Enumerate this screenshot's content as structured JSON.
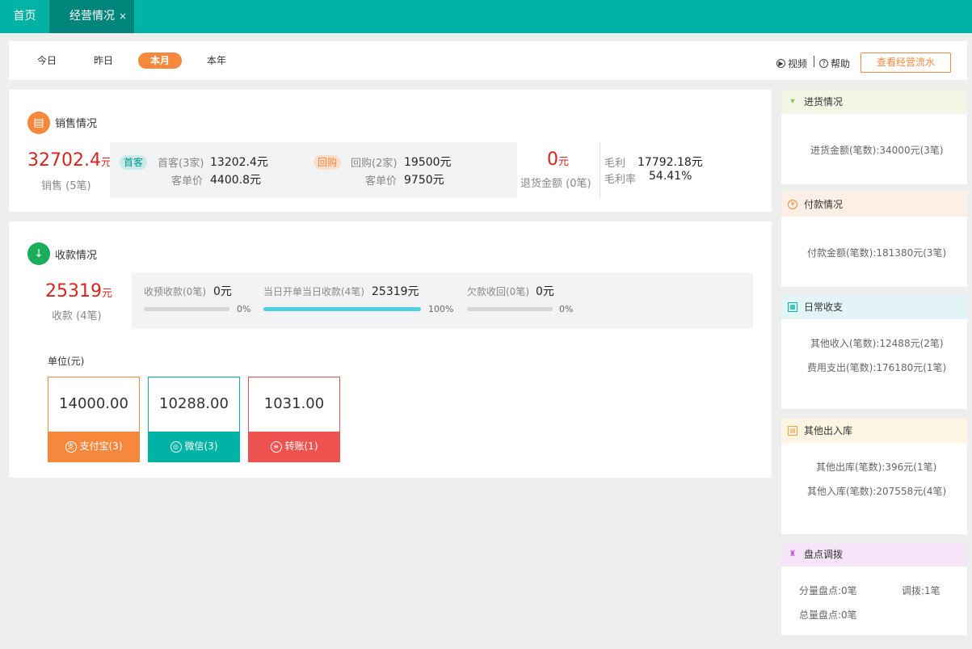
{
  "tabs": {
    "home": "首页",
    "active": "经营情况",
    "close": "×"
  },
  "filters": [
    "今日",
    "昨日",
    "本月",
    "本年"
  ],
  "toolbar": {
    "video": "视频",
    "help": "帮助",
    "flow_button": "查看经营流水"
  },
  "sales": {
    "title": "销售情况",
    "total": "32702.4",
    "total_unit": "元",
    "total_label": "销售 (5笔)",
    "first": {
      "badge": "首客",
      "label": "首客(3家)",
      "value": "13202.4元",
      "unit_label": "客单价",
      "unit_value": "4400.8元"
    },
    "repeat": {
      "badge": "回购",
      "label": "回购(2家)",
      "value": "19500元",
      "unit_label": "客单价",
      "unit_value": "9750元"
    },
    "refund": {
      "value": "0",
      "unit": "元",
      "label": "退货金额 (0笔)"
    },
    "gross_profit_label": "毛利",
    "gross_profit": "17792.18元",
    "gross_margin_label": "毛利率",
    "gross_margin": "54.41%"
  },
  "collection": {
    "title": "收款情况",
    "total": "25319",
    "total_unit": "元",
    "total_label": "收款 (4笔)",
    "items": [
      {
        "label": "收预收款(0笔)",
        "value": "0元",
        "percent_text": "0%",
        "percent": 0
      },
      {
        "label": "当日开单当日收款(4笔)",
        "value": "25319元",
        "percent_text": "100%",
        "percent": 100
      },
      {
        "label": "欠款收回(0笔)",
        "value": "0元",
        "percent_text": "0%",
        "percent": 0
      }
    ],
    "unit_label": "单位(元)",
    "methods": [
      {
        "amount": "14000.00",
        "label": "支付宝(3)",
        "color": "#f5883c"
      },
      {
        "amount": "10288.00",
        "label": "微信(3)",
        "color": "#00b3a4"
      },
      {
        "amount": "1031.00",
        "label": "转账(1)",
        "color": "#ef5350"
      }
    ]
  },
  "side": {
    "purchase": {
      "title": "进货情况",
      "line": "进货金额(笔数):34000元(3笔)"
    },
    "payment": {
      "title": "付款情况",
      "line": "付款金额(笔数):181380元(3笔)"
    },
    "daily": {
      "title": "日常收支",
      "income": "其他收入(笔数):12488元(2笔)",
      "expense": "费用支出(笔数):176180元(1笔)"
    },
    "stock": {
      "title": "其他出入库",
      "out": "其他出库(笔数):396元(1笔)",
      "in": "其他入库(笔数):207558元(4笔)"
    },
    "inventory": {
      "title": "盘点调拨",
      "split": "分量盘点:0笔",
      "transfer": "调拨:1笔",
      "total": "总量盘点:0笔"
    }
  },
  "colors": {
    "teal": "#00b3a4",
    "orange": "#f5883c",
    "red": "#d9251c"
  }
}
